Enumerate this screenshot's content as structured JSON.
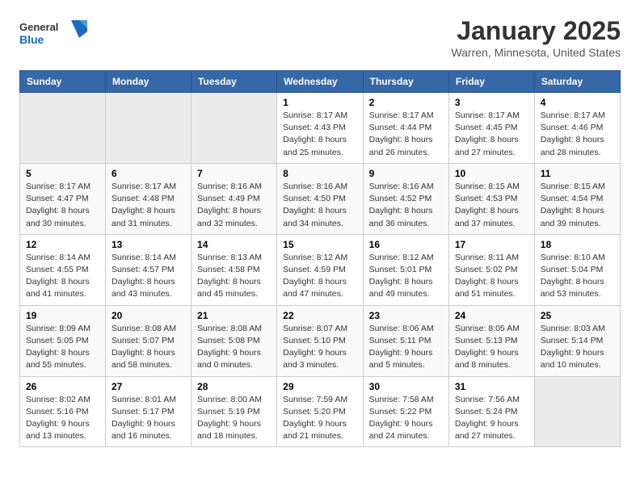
{
  "logo": {
    "general": "General",
    "blue": "Blue"
  },
  "title": "January 2025",
  "location": "Warren, Minnesota, United States",
  "weekdays": [
    "Sunday",
    "Monday",
    "Tuesday",
    "Wednesday",
    "Thursday",
    "Friday",
    "Saturday"
  ],
  "weeks": [
    [
      {
        "day": "",
        "info": ""
      },
      {
        "day": "",
        "info": ""
      },
      {
        "day": "",
        "info": ""
      },
      {
        "day": "1",
        "info": "Sunrise: 8:17 AM\nSunset: 4:43 PM\nDaylight: 8 hours\nand 25 minutes."
      },
      {
        "day": "2",
        "info": "Sunrise: 8:17 AM\nSunset: 4:44 PM\nDaylight: 8 hours\nand 26 minutes."
      },
      {
        "day": "3",
        "info": "Sunrise: 8:17 AM\nSunset: 4:45 PM\nDaylight: 8 hours\nand 27 minutes."
      },
      {
        "day": "4",
        "info": "Sunrise: 8:17 AM\nSunset: 4:46 PM\nDaylight: 8 hours\nand 28 minutes."
      }
    ],
    [
      {
        "day": "5",
        "info": "Sunrise: 8:17 AM\nSunset: 4:47 PM\nDaylight: 8 hours\nand 30 minutes."
      },
      {
        "day": "6",
        "info": "Sunrise: 8:17 AM\nSunset: 4:48 PM\nDaylight: 8 hours\nand 31 minutes."
      },
      {
        "day": "7",
        "info": "Sunrise: 8:16 AM\nSunset: 4:49 PM\nDaylight: 8 hours\nand 32 minutes."
      },
      {
        "day": "8",
        "info": "Sunrise: 8:16 AM\nSunset: 4:50 PM\nDaylight: 8 hours\nand 34 minutes."
      },
      {
        "day": "9",
        "info": "Sunrise: 8:16 AM\nSunset: 4:52 PM\nDaylight: 8 hours\nand 36 minutes."
      },
      {
        "day": "10",
        "info": "Sunrise: 8:15 AM\nSunset: 4:53 PM\nDaylight: 8 hours\nand 37 minutes."
      },
      {
        "day": "11",
        "info": "Sunrise: 8:15 AM\nSunset: 4:54 PM\nDaylight: 8 hours\nand 39 minutes."
      }
    ],
    [
      {
        "day": "12",
        "info": "Sunrise: 8:14 AM\nSunset: 4:55 PM\nDaylight: 8 hours\nand 41 minutes."
      },
      {
        "day": "13",
        "info": "Sunrise: 8:14 AM\nSunset: 4:57 PM\nDaylight: 8 hours\nand 43 minutes."
      },
      {
        "day": "14",
        "info": "Sunrise: 8:13 AM\nSunset: 4:58 PM\nDaylight: 8 hours\nand 45 minutes."
      },
      {
        "day": "15",
        "info": "Sunrise: 8:12 AM\nSunset: 4:59 PM\nDaylight: 8 hours\nand 47 minutes."
      },
      {
        "day": "16",
        "info": "Sunrise: 8:12 AM\nSunset: 5:01 PM\nDaylight: 8 hours\nand 49 minutes."
      },
      {
        "day": "17",
        "info": "Sunrise: 8:11 AM\nSunset: 5:02 PM\nDaylight: 8 hours\nand 51 minutes."
      },
      {
        "day": "18",
        "info": "Sunrise: 8:10 AM\nSunset: 5:04 PM\nDaylight: 8 hours\nand 53 minutes."
      }
    ],
    [
      {
        "day": "19",
        "info": "Sunrise: 8:09 AM\nSunset: 5:05 PM\nDaylight: 8 hours\nand 55 minutes."
      },
      {
        "day": "20",
        "info": "Sunrise: 8:08 AM\nSunset: 5:07 PM\nDaylight: 8 hours\nand 58 minutes."
      },
      {
        "day": "21",
        "info": "Sunrise: 8:08 AM\nSunset: 5:08 PM\nDaylight: 9 hours\nand 0 minutes."
      },
      {
        "day": "22",
        "info": "Sunrise: 8:07 AM\nSunset: 5:10 PM\nDaylight: 9 hours\nand 3 minutes."
      },
      {
        "day": "23",
        "info": "Sunrise: 8:06 AM\nSunset: 5:11 PM\nDaylight: 9 hours\nand 5 minutes."
      },
      {
        "day": "24",
        "info": "Sunrise: 8:05 AM\nSunset: 5:13 PM\nDaylight: 9 hours\nand 8 minutes."
      },
      {
        "day": "25",
        "info": "Sunrise: 8:03 AM\nSunset: 5:14 PM\nDaylight: 9 hours\nand 10 minutes."
      }
    ],
    [
      {
        "day": "26",
        "info": "Sunrise: 8:02 AM\nSunset: 5:16 PM\nDaylight: 9 hours\nand 13 minutes."
      },
      {
        "day": "27",
        "info": "Sunrise: 8:01 AM\nSunset: 5:17 PM\nDaylight: 9 hours\nand 16 minutes."
      },
      {
        "day": "28",
        "info": "Sunrise: 8:00 AM\nSunset: 5:19 PM\nDaylight: 9 hours\nand 18 minutes."
      },
      {
        "day": "29",
        "info": "Sunrise: 7:59 AM\nSunset: 5:20 PM\nDaylight: 9 hours\nand 21 minutes."
      },
      {
        "day": "30",
        "info": "Sunrise: 7:58 AM\nSunset: 5:22 PM\nDaylight: 9 hours\nand 24 minutes."
      },
      {
        "day": "31",
        "info": "Sunrise: 7:56 AM\nSunset: 5:24 PM\nDaylight: 9 hours\nand 27 minutes."
      },
      {
        "day": "",
        "info": ""
      }
    ]
  ]
}
